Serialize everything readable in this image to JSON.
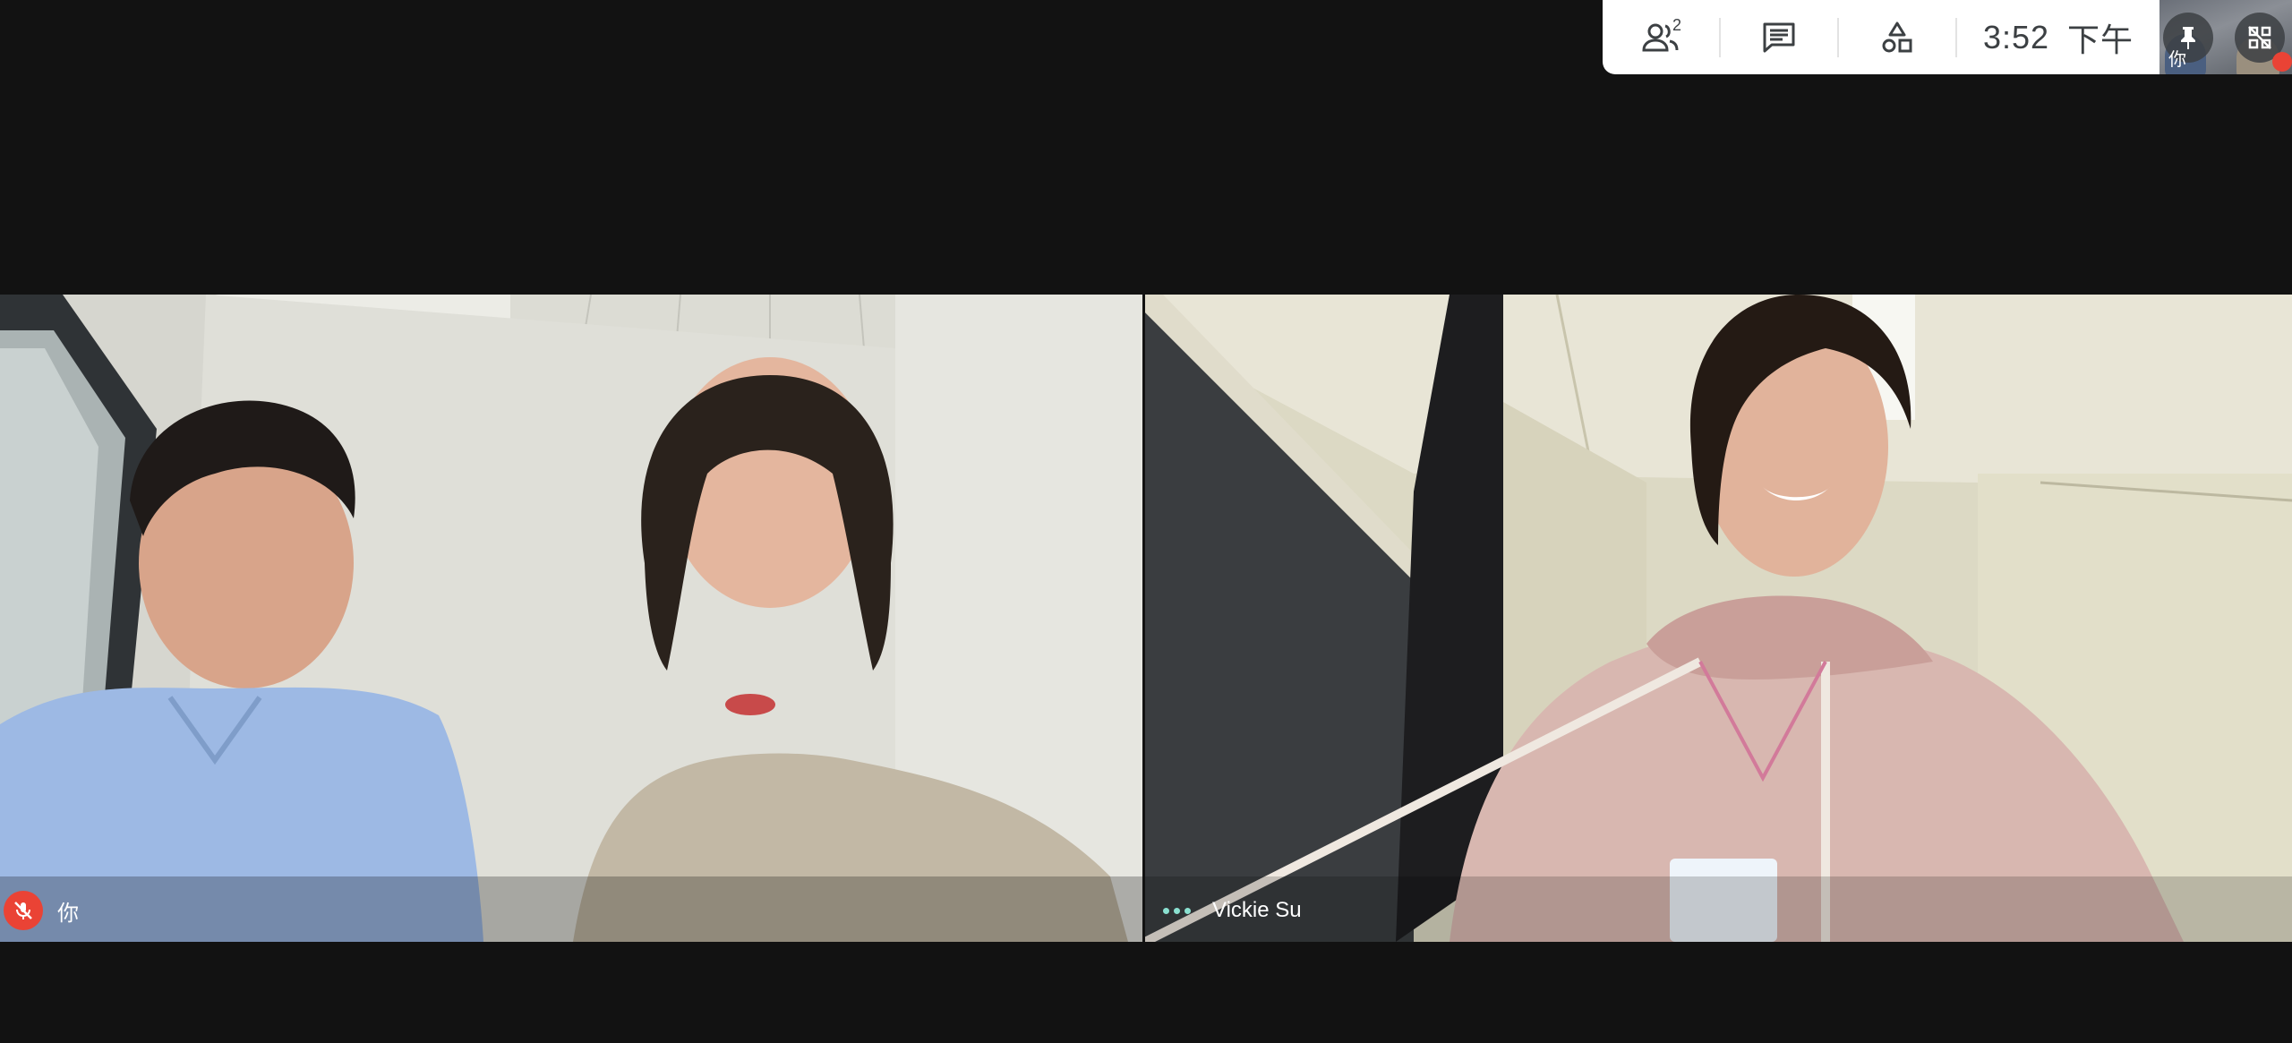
{
  "toolbar": {
    "participants_icon": "people-icon",
    "participants_count": "2",
    "chat_icon": "chat-icon",
    "activities_icon": "shapes-icon",
    "time": "3:52",
    "period": "下午"
  },
  "self_view": {
    "label": "你",
    "pin_icon": "pin-icon",
    "tiles_icon": "grid-off-icon"
  },
  "tiles": [
    {
      "name": "你",
      "status_icon": "mic-off-icon"
    },
    {
      "name": "Vickie Su",
      "status_icon": "more-dots-icon"
    }
  ],
  "colors": {
    "mute_red": "#ea4335",
    "speaking_teal": "#8ae0d0",
    "background": "#121212"
  }
}
